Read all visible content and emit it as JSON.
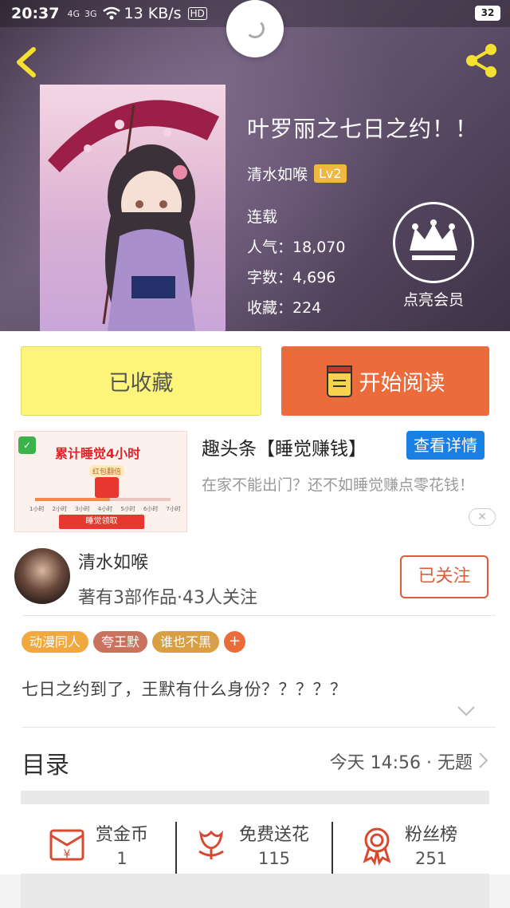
{
  "status_bar": {
    "time": "20:37",
    "network_1": "4G",
    "network_2": "3G",
    "speed": "13 KB/s",
    "hd": "HD",
    "battery": "32"
  },
  "book": {
    "title": "叶罗丽之七日之约！！",
    "author": "清水如喉",
    "level": "Lv2",
    "status": "连载",
    "popularity": "人气：18,070",
    "word_count": "字数：4,696",
    "favorites": "收藏：224"
  },
  "vip": {
    "label": "点亮会员"
  },
  "actions": {
    "favorite_label": "已收藏",
    "read_label": "开始阅读"
  },
  "ad": {
    "image_headline": "累计睡觉4小时",
    "image_sub": "红包翻倍",
    "image_ticks": [
      "1小时",
      "2小时",
      "3小时",
      "4小时",
      "5小时",
      "6小时",
      "7小时"
    ],
    "image_cta": "睡觉领取",
    "title": "趣头条【睡觉赚钱】",
    "detail_button": "查看详情",
    "description": "在家不能出门？还不如睡觉赚点零花钱！",
    "close": "✕"
  },
  "author": {
    "name": "清水如喉",
    "stats": "著有3部作品·43人关注",
    "follow_label": "已关注"
  },
  "tags": [
    {
      "label": "动漫同人",
      "color": "#f1a93f"
    },
    {
      "label": "夸王默",
      "color": "#c9735f"
    },
    {
      "label": "谁也不黑",
      "color": "#d9a043"
    }
  ],
  "tag_add": "+",
  "summary": "七日之约到了，王默有什么身份？？？？？",
  "toc": {
    "label": "目录",
    "latest": "今天 14:56 · 无题"
  },
  "stats": [
    {
      "label": "赏金币",
      "value": "1",
      "icon": "reward-coin-icon"
    },
    {
      "label": "免费送花",
      "value": "115",
      "icon": "flower-icon"
    },
    {
      "label": "粉丝榜",
      "value": "251",
      "icon": "medal-icon"
    }
  ],
  "colors": {
    "accent_orange": "#ec6b3a",
    "favorite_yellow": "#fdf57a",
    "ad_blue": "#1a7fe2",
    "icon_red": "#d84a30"
  }
}
